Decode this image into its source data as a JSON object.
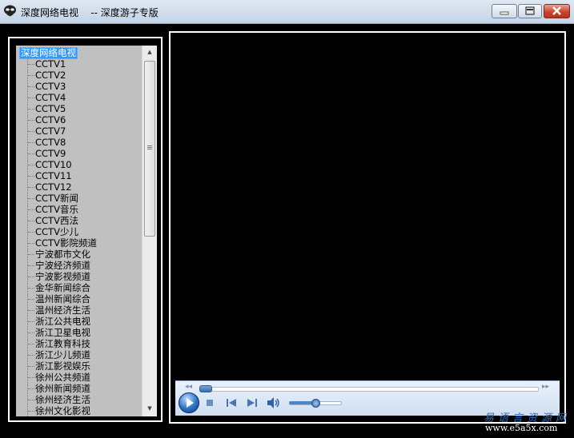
{
  "window": {
    "title": "深度网络电视    -- 深度游子专版",
    "minimize_glyph": "—",
    "maximize_glyph": "▫",
    "close_glyph": "✕"
  },
  "tree": {
    "root_label": "深度网络电视",
    "channels": [
      "CCTV1",
      "CCTV2",
      "CCTV3",
      "CCTV4",
      "CCTV5",
      "CCTV6",
      "CCTV7",
      "CCTV8",
      "CCTV9",
      "CCTV10",
      "CCTV11",
      "CCTV12",
      "CCTV新闻",
      "CCTV音乐",
      "CCTV西法",
      "CCTV少儿",
      "CCTV影院频道",
      "宁波都市文化",
      "宁波经济频道",
      "宁波影视频道",
      "金华新闻综合",
      "温州新闻综合",
      "温州经济生活",
      "浙江公共电视",
      "浙江卫星电视",
      "浙江教育科技",
      "浙江少儿频道",
      "浙江影视娱乐",
      "徐州公共频道",
      "徐州新闻频道",
      "徐州经济生活",
      "徐州文化影视"
    ]
  },
  "player": {
    "seek_progress": 0.0,
    "volume_level": 0.5
  },
  "watermark": {
    "line1": "易语言资源网",
    "line2": "www.e5a5x.com"
  },
  "colors": {
    "selection": "#3399ff",
    "tree_bg": "#c0c0c0",
    "close_button": "#c9462f"
  }
}
